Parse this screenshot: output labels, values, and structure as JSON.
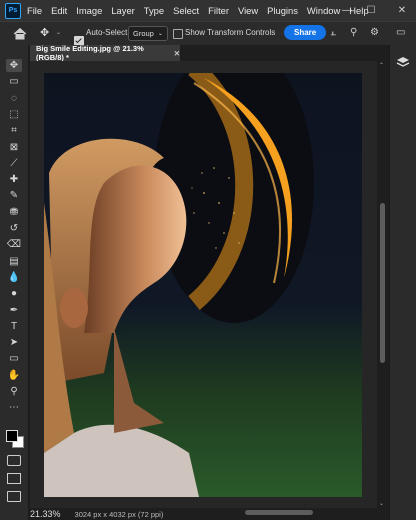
{
  "app": {
    "logo_text": "Ps"
  },
  "menu": [
    "File",
    "Edit",
    "Image",
    "Layer",
    "Type",
    "Select",
    "Filter",
    "View",
    "Plugins",
    "Window",
    "Help"
  ],
  "window_controls": {
    "minimize": "—",
    "maximize": "☐",
    "close": "✕"
  },
  "options": {
    "auto_select_label": "Auto-Select:",
    "auto_select_checked": true,
    "group_value": "Group",
    "transform_label": "Show Transform Controls",
    "transform_checked": false,
    "share_label": "Share"
  },
  "document": {
    "tab_title": "Big Smile Editing.jpg @ 21.3% (RGB/8) *"
  },
  "status": {
    "zoom": "21.33%",
    "info": "3024 px x 4032 px (72 ppi)"
  },
  "colors": {
    "accent": "#1473e6",
    "orb": "#f39a1c",
    "bg": "#1e1e1e"
  },
  "tools": [
    "move-icon",
    "artboard-icon",
    "lasso-icon",
    "object-select-icon",
    "crop-icon",
    "frame-icon",
    "eyedropper-icon",
    "healing-brush-icon",
    "brush-icon",
    "clone-stamp-icon",
    "history-brush-icon",
    "eraser-icon",
    "gradient-icon",
    "blur-icon",
    "dodge-icon",
    "pen-icon",
    "type-icon",
    "path-select-icon",
    "rectangle-icon",
    "hand-icon",
    "zoom-icon",
    "more-icon"
  ]
}
